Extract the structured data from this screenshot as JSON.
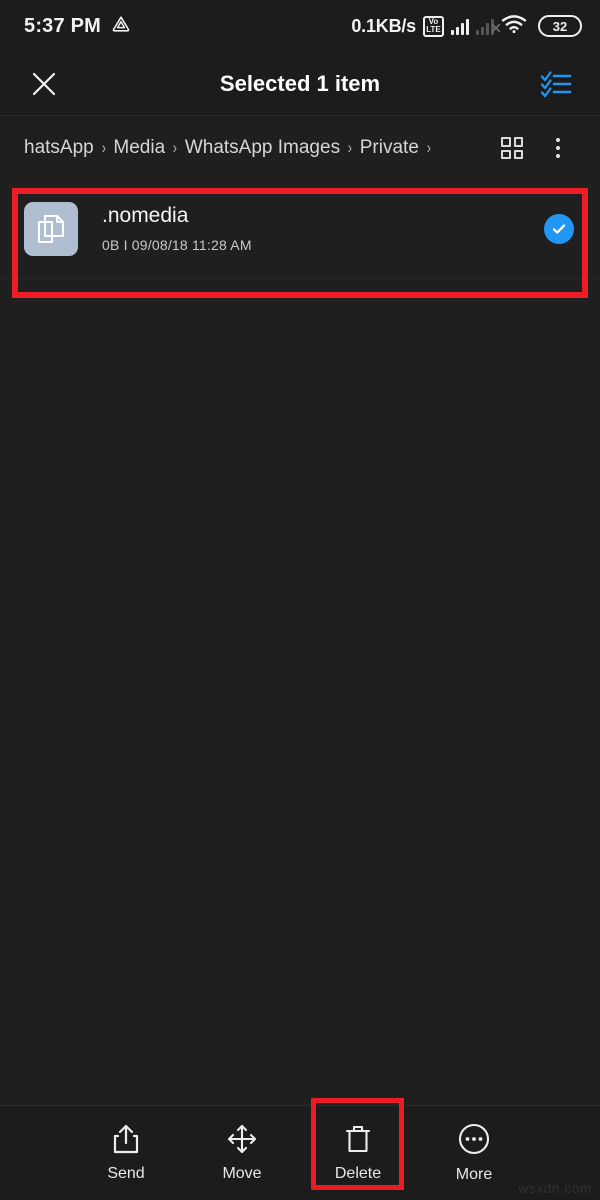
{
  "status_bar": {
    "time": "5:37 PM",
    "app_icon": "triangle-app-icon",
    "net_speed": "0.1KB/s",
    "volte_top": "Vo",
    "volte_bottom": "LTE",
    "signal_icon": "signal-bars-icon",
    "signal_secondary_icon": "signal-bars-no-service-icon",
    "wifi_icon": "wifi-icon",
    "battery_level": "32"
  },
  "app_bar": {
    "close_icon": "close-icon",
    "title": "Selected 1 item",
    "select_all_icon": "select-all-checklist-icon"
  },
  "breadcrumb": {
    "items": [
      {
        "label": "hatsApp"
      },
      {
        "label": "Media"
      },
      {
        "label": "WhatsApp Images"
      },
      {
        "label": "Private"
      }
    ],
    "separator": "›",
    "grid_view_icon": "grid-view-icon",
    "overflow_icon": "more-vertical-icon"
  },
  "file_list": {
    "rows": [
      {
        "icon": "document-copy-icon",
        "name": ".nomedia",
        "size": "0B",
        "meta_separator": "I",
        "date": "09/08/18 11:28 AM",
        "meta": "0B  I  09/08/18 11:28 AM",
        "selected": true,
        "check_icon": "check-circle-icon"
      }
    ]
  },
  "bottom_bar": {
    "actions": [
      {
        "icon": "share-icon",
        "label": "Send"
      },
      {
        "icon": "move-arrows-icon",
        "label": "Move"
      },
      {
        "icon": "trash-icon",
        "label": "Delete"
      },
      {
        "icon": "more-circle-icon",
        "label": "More"
      }
    ]
  },
  "highlights": {
    "color": "#ed1c24",
    "targets": [
      "file-row-nomedia",
      "delete-button"
    ]
  },
  "watermark": {
    "text": "wsxdn.com"
  },
  "colors": {
    "background": "#1f1f1f",
    "bar_background": "#1c1c1c",
    "accent_blue": "#2196f3",
    "highlight_red": "#ed1c24",
    "thumb_blue": "#aebdd0"
  }
}
